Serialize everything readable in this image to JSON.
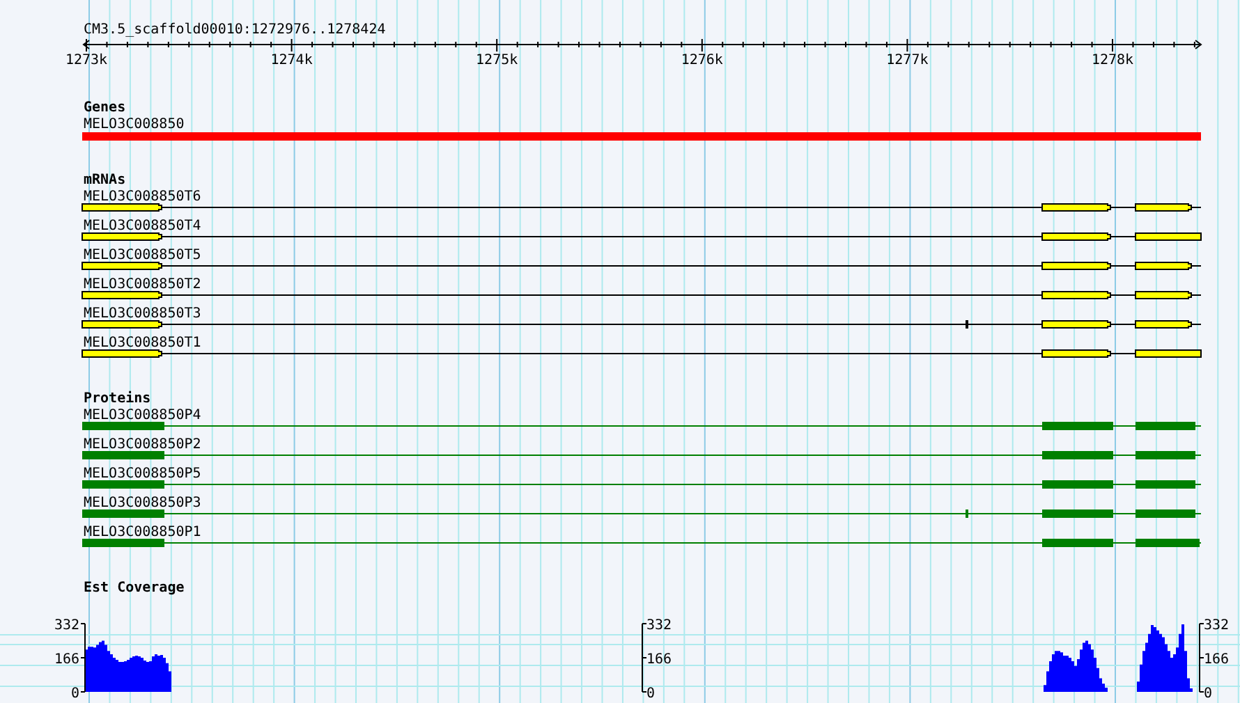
{
  "ruler": {
    "title": "CM3.5_scaffold00010:1272976..1278424",
    "tick_labels": [
      "1273k",
      "1274k",
      "1275k",
      "1276k",
      "1277k",
      "1278k"
    ]
  },
  "tracks": [
    {
      "kind": "gene",
      "title": "Genes",
      "features": [
        {
          "name": "MELO3C008850"
        }
      ]
    },
    {
      "kind": "mrna",
      "title": "mRNAs",
      "features": [
        {
          "name": "MELO3C008850T6"
        },
        {
          "name": "MELO3C008850T4"
        },
        {
          "name": "MELO3C008850T5"
        },
        {
          "name": "MELO3C008850T2"
        },
        {
          "name": "MELO3C008850T3"
        },
        {
          "name": "MELO3C008850T1"
        }
      ]
    },
    {
      "kind": "protein",
      "title": "Proteins",
      "features": [
        {
          "name": "MELO3C008850P4"
        },
        {
          "name": "MELO3C008850P2"
        },
        {
          "name": "MELO3C008850P5"
        },
        {
          "name": "MELO3C008850P3"
        },
        {
          "name": "MELO3C008850P1"
        }
      ]
    },
    {
      "kind": "coverage",
      "title": "Est Coverage",
      "axes": [
        [
          "332",
          "166",
          "0"
        ],
        [
          "332",
          "166",
          "0"
        ],
        [
          "332",
          "166",
          "0"
        ]
      ]
    }
  ]
}
